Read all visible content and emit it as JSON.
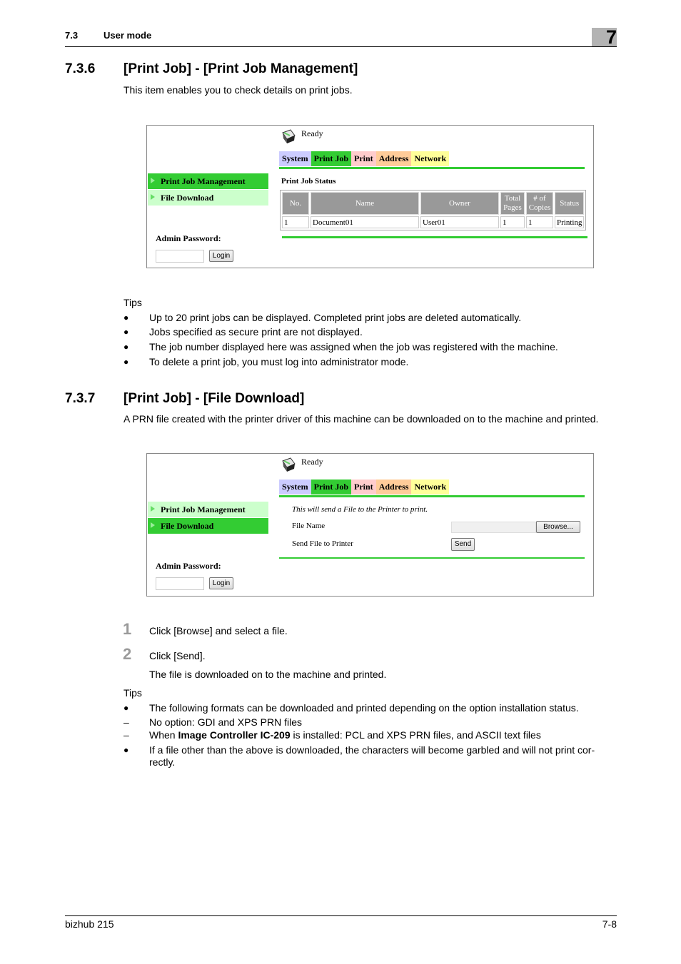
{
  "header": {
    "section_number": "7.3",
    "section_title": "User mode",
    "chapter": "7"
  },
  "section_736": {
    "number": "7.3.6",
    "title": "[Print Job] - [Print Job Management]",
    "intro": "This item enables you to check details on print jobs.",
    "screenshot": {
      "status": "Ready",
      "tabs": [
        "System",
        "Print Job",
        "Print",
        "Address",
        "Network"
      ],
      "sidebar": [
        {
          "label": "Print Job Management",
          "active": true
        },
        {
          "label": "File Download",
          "active": false
        }
      ],
      "admin_password_label": "Admin Password:",
      "login_label": "Login",
      "table_title": "Print Job Status",
      "columns": [
        "No.",
        "Name",
        "Owner",
        "Total Pages",
        "# of Copies",
        "Status"
      ],
      "rows": [
        [
          "1",
          "Document01",
          "User01",
          "1",
          "1",
          "Printing"
        ]
      ]
    },
    "tips_label": "Tips",
    "tips": [
      "Up to 20 print jobs can be displayed. Completed print jobs are deleted automatically.",
      "Jobs specified as secure print are not displayed.",
      "The job number displayed here was assigned when the job was registered with the machine.",
      "To delete a print job, you must log into administrator mode."
    ]
  },
  "section_737": {
    "number": "7.3.7",
    "title": "[Print Job] - [File Download]",
    "intro": "A PRN file created with the printer driver of this machine can be downloaded on to the machine and printed.",
    "screenshot": {
      "status": "Ready",
      "tabs": [
        "System",
        "Print Job",
        "Print",
        "Address",
        "Network"
      ],
      "sidebar": [
        {
          "label": "Print Job Management",
          "active": false
        },
        {
          "label": "File Download",
          "active": true
        }
      ],
      "admin_password_label": "Admin Password:",
      "login_label": "Login",
      "note": "This will send a File to the Printer to print.",
      "file_name_label": "File Name",
      "file_name_value": "",
      "browse_label": "Browse...",
      "send_label_text": "Send File to Printer",
      "send_label": "Send"
    },
    "steps": [
      {
        "num": "1",
        "text": "Click [Browse] and select a file."
      },
      {
        "num": "2",
        "text": "Click [Send]."
      }
    ],
    "step_result": "The file is downloaded on to the machine and printed.",
    "tips_label": "Tips",
    "tip1": "The following formats can be downloaded and printed depending on the option installation status.",
    "sub1": "No option: GDI and XPS PRN files",
    "sub2_prefix": "When ",
    "sub2_bold": "Image Controller IC-209",
    "sub2_suffix": " is installed: PCL and XPS PRN files, and ASCII text files",
    "tip2_line1": "If a file other than the above is downloaded, the characters will become garbled and will not print cor-",
    "tip2_line2": "rectly."
  },
  "footer": {
    "product": "bizhub 215",
    "page": "7-8"
  },
  "colors": {
    "green": "#33cc33",
    "light_green": "#ccffcc",
    "system_tab": "#ccccff",
    "print_tab": "#ffcccc",
    "address_tab": "#ffcc99",
    "network_tab": "#ffff99",
    "table_header": "#999999"
  }
}
